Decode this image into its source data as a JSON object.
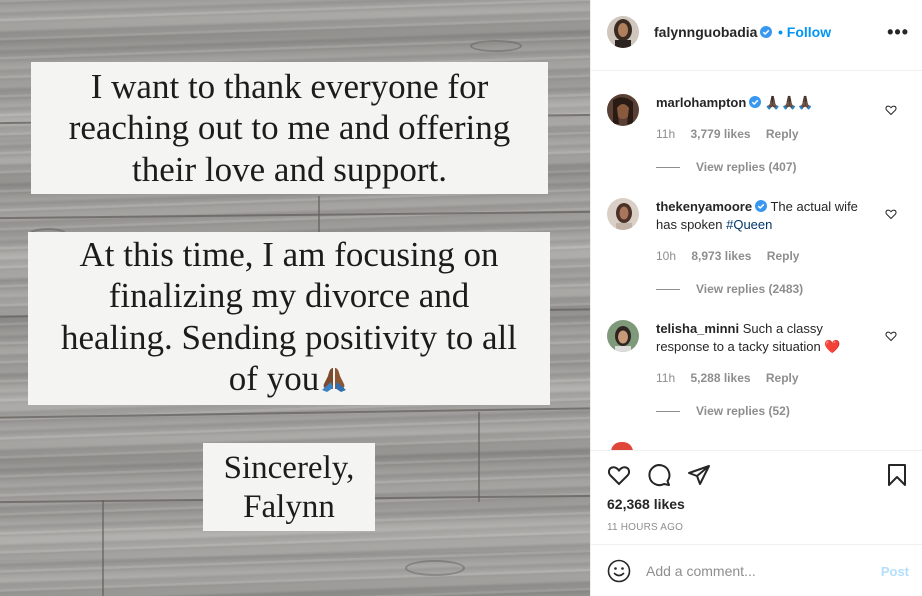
{
  "post_image": {
    "card1_lines": [
      "I want to thank everyone for",
      "reaching out to me and offering",
      "their love and support."
    ],
    "card2_lines": [
      "At this time, I am focusing on",
      "finalizing my divorce and",
      "healing. Sending positivity to all",
      "of you"
    ],
    "card3_lines": [
      "Sincerely,",
      "Falynn"
    ],
    "pray_emoji": "folded-hands-icon"
  },
  "header": {
    "username": "falynnguobadia",
    "follow_label": "Follow",
    "more_icon": "more-options-icon",
    "verified_icon": "verified-badge-icon"
  },
  "comments": [
    {
      "username": "marlohampton",
      "verified": true,
      "text": "🙏🏿🙏🏿🙏🏿",
      "hashtag": "",
      "text_after": "",
      "time": "11h",
      "likes": "3,779 likes",
      "reply_label": "Reply",
      "view_replies": "View replies (407)"
    },
    {
      "username": "thekenyamoore",
      "verified": true,
      "text": "The actual wife has spoken ",
      "hashtag": "#Queen",
      "text_after": "",
      "time": "10h",
      "likes": "8,973 likes",
      "reply_label": "Reply",
      "view_replies": "View replies (2483)"
    },
    {
      "username": "telisha_minni",
      "verified": false,
      "text": "Such a classy response to a tacky situation ",
      "hashtag": "",
      "text_after": "❤️",
      "time": "11h",
      "likes": "5,288 likes",
      "reply_label": "Reply",
      "view_replies": "View replies (52)"
    }
  ],
  "actions": {
    "like_icon": "heart-icon",
    "comment_icon": "comment-icon",
    "share_icon": "share-icon",
    "save_icon": "bookmark-icon",
    "likes_count": "62,368 likes",
    "timestamp": "11 HOURS AGO"
  },
  "add_comment": {
    "emoji_icon": "emoji-icon",
    "placeholder": "Add a comment...",
    "post_label": "Post"
  },
  "colors": {
    "link_blue": "#0095f6",
    "hashtag_blue": "#00376b",
    "muted_gray": "#8e8e8e",
    "border": "#efefef",
    "post_disabled": "#b2dffc"
  }
}
